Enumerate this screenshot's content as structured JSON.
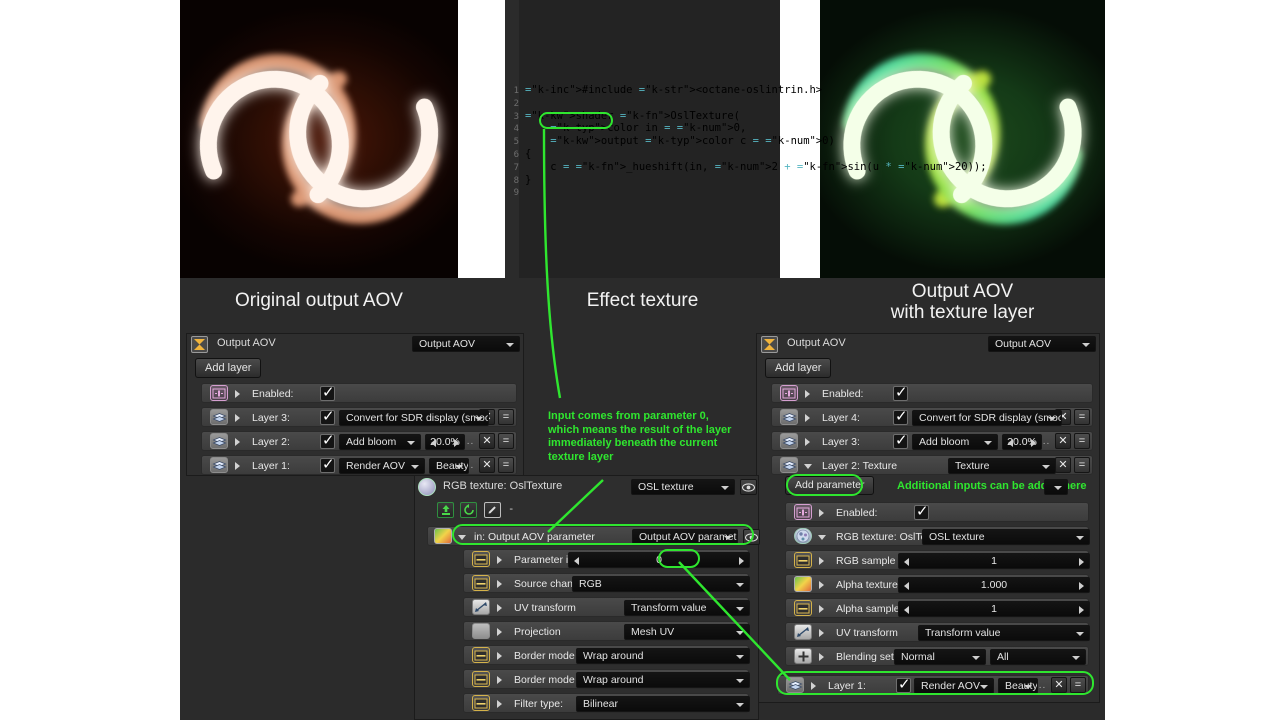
{
  "captions": {
    "left": "Original output AOV",
    "middle": "Effect texture",
    "right_line1": "Output AOV",
    "right_line2": "with texture layer"
  },
  "accent_color": "#2fe62f",
  "code_editor": {
    "language": "OSL",
    "lines": [
      {
        "n": "1",
        "text": "#include <octane-oslintrin.h>"
      },
      {
        "n": "2",
        "text": ""
      },
      {
        "n": "3",
        "text": "shader OslTexture("
      },
      {
        "n": "4",
        "text": "    color in = 0,"
      },
      {
        "n": "5",
        "text": "    output color c = 0)"
      },
      {
        "n": "6",
        "text": "{"
      },
      {
        "n": "7",
        "text": "    c = _hueshift(in, 2 + sin(u * 20));"
      },
      {
        "n": "8",
        "text": "}"
      },
      {
        "n": "9",
        "text": ""
      }
    ]
  },
  "left_panel": {
    "title": "Output AOV",
    "header_select": "Output AOV",
    "add_layer_label": "Add layer",
    "rows": [
      {
        "label": "Enabled:",
        "icon": "pin-icon",
        "checkbox": true
      },
      {
        "label": "Layer 3:",
        "icon": "layer-icon",
        "checkbox": true,
        "select1": "Convert for SDR display (smooth)",
        "dots": "...",
        "close": "✕",
        "menu": "="
      },
      {
        "label": "Layer 2:",
        "icon": "layer-icon",
        "checkbox": true,
        "select1": "Add bloom",
        "spinner": "20.0%",
        "dots": "...",
        "close": "✕",
        "menu": "="
      },
      {
        "label": "Layer 1:",
        "icon": "layer-icon",
        "checkbox": true,
        "select1": "Render AOV",
        "select2": "Beauty",
        "dots": "...",
        "close": "✕",
        "menu": "="
      }
    ]
  },
  "right_panel": {
    "title": "Output AOV",
    "header_select": "Output AOV",
    "add_layer_label": "Add layer",
    "add_parameter_label": "Add parameter",
    "add_parameter_note": "Additional inputs can be added here",
    "rows": [
      {
        "label": "Enabled:",
        "icon": "pin-icon",
        "checkbox": true
      },
      {
        "label": "Layer 4:",
        "icon": "layer-icon",
        "checkbox": true,
        "select1": "Convert for SDR display (smooth)",
        "dots": "...",
        "close": "✕",
        "menu": "="
      },
      {
        "label": "Layer 3:",
        "icon": "layer-icon",
        "checkbox": true,
        "select1": "Add bloom",
        "spinner": "20.0%",
        "dots": "...",
        "close": "✕",
        "menu": "="
      },
      {
        "label": "Layer 2:  Texture",
        "icon": "layer-icon",
        "select1": "Texture",
        "close": "✕",
        "menu": "="
      }
    ],
    "texture_params": [
      {
        "label": "Enabled:",
        "icon": "pin-icon",
        "checkbox": true
      },
      {
        "label": "RGB texture: OslTexture",
        "icon": "sphere-icon",
        "select1": "OSL texture"
      },
      {
        "label": "RGB sample count:",
        "icon": "slider-icon",
        "spinner": "1"
      },
      {
        "label": "Alpha texture:",
        "icon": "gradient-icon",
        "spinner": "1.000"
      },
      {
        "label": "Alpha sample count:",
        "icon": "slider-icon",
        "spinner": "1"
      },
      {
        "label": "UV transform",
        "icon": "transform-icon",
        "select1": "Transform value"
      },
      {
        "label": "Blending settings:",
        "icon": "plus-icon",
        "select1": "Normal",
        "select2": "All"
      }
    ],
    "bottom_row": {
      "label": "Layer 1:",
      "icon": "layer-icon",
      "checkbox": true,
      "select1": "Render AOV",
      "select2": "Beauty",
      "dots": "...",
      "close": "✕",
      "menu": "="
    }
  },
  "center_panel": {
    "title": "RGB texture: OslTexture",
    "header_select": "OSL texture",
    "toolbar": {
      "load": "load-icon",
      "reload": "reload-icon",
      "edit": "edit-icon",
      "filename": "-"
    },
    "input_row": {
      "label": "in: Output AOV parameter",
      "select": "Output AOV parameter",
      "icon": "gradient-icon"
    },
    "params": [
      {
        "label": "Parameter index:",
        "icon": "slider-icon",
        "spinner": "0"
      },
      {
        "label": "Source channel(s):",
        "icon": "slider-icon",
        "select1": "RGB"
      },
      {
        "label": "UV transform",
        "icon": "transform-icon",
        "select1": "Transform value"
      },
      {
        "label": "Projection",
        "icon": "plain-icon",
        "select1": "Mesh UV"
      },
      {
        "label": "Border mode (U):",
        "icon": "slider-icon",
        "select1": "Wrap around"
      },
      {
        "label": "Border mode (V):",
        "icon": "slider-icon",
        "select1": "Wrap around"
      },
      {
        "label": "Filter type:",
        "icon": "slider-icon",
        "select1": "Bilinear"
      }
    ]
  },
  "annotations": {
    "param_note": "Input comes from parameter 0,\nwhich means the result of the layer\nimmediately beneath the current\ntexture layer"
  }
}
